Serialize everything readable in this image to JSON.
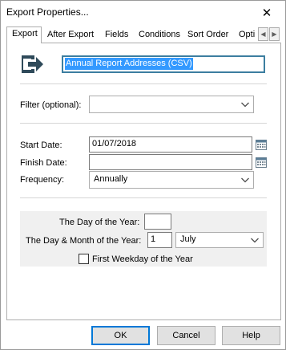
{
  "window": {
    "title": "Export Properties...",
    "close_glyph": "✕"
  },
  "tabs": [
    {
      "label": "Export",
      "active": true
    },
    {
      "label": "After Export"
    },
    {
      "label": "Fields"
    },
    {
      "label": "Conditions"
    },
    {
      "label": "Sort Order"
    },
    {
      "label": "Opti"
    }
  ],
  "export": {
    "icon": "export-arrow-icon",
    "name_value": "Annual Report Addresses (CSV)",
    "filter_label": "Filter (optional):",
    "filter_value": "",
    "start_date_label": "Start Date:",
    "start_date_value": "01/07/2018",
    "finish_date_label": "Finish Date:",
    "finish_date_value": "",
    "frequency_label": "Frequency:",
    "frequency_value": "Annually",
    "day_of_year_label": "The Day of the Year:",
    "day_of_year_value": "",
    "day_month_label": "The Day & Month of the Year:",
    "day_value": "1",
    "month_value": "July",
    "first_weekday_label": "First Weekday of the Year",
    "first_weekday_checked": false
  },
  "buttons": {
    "ok": "OK",
    "cancel": "Cancel",
    "help": "Help"
  },
  "colors": {
    "selection": "#3399ff",
    "focus_border": "#0078d7",
    "group_bg": "#f0f0f0"
  }
}
